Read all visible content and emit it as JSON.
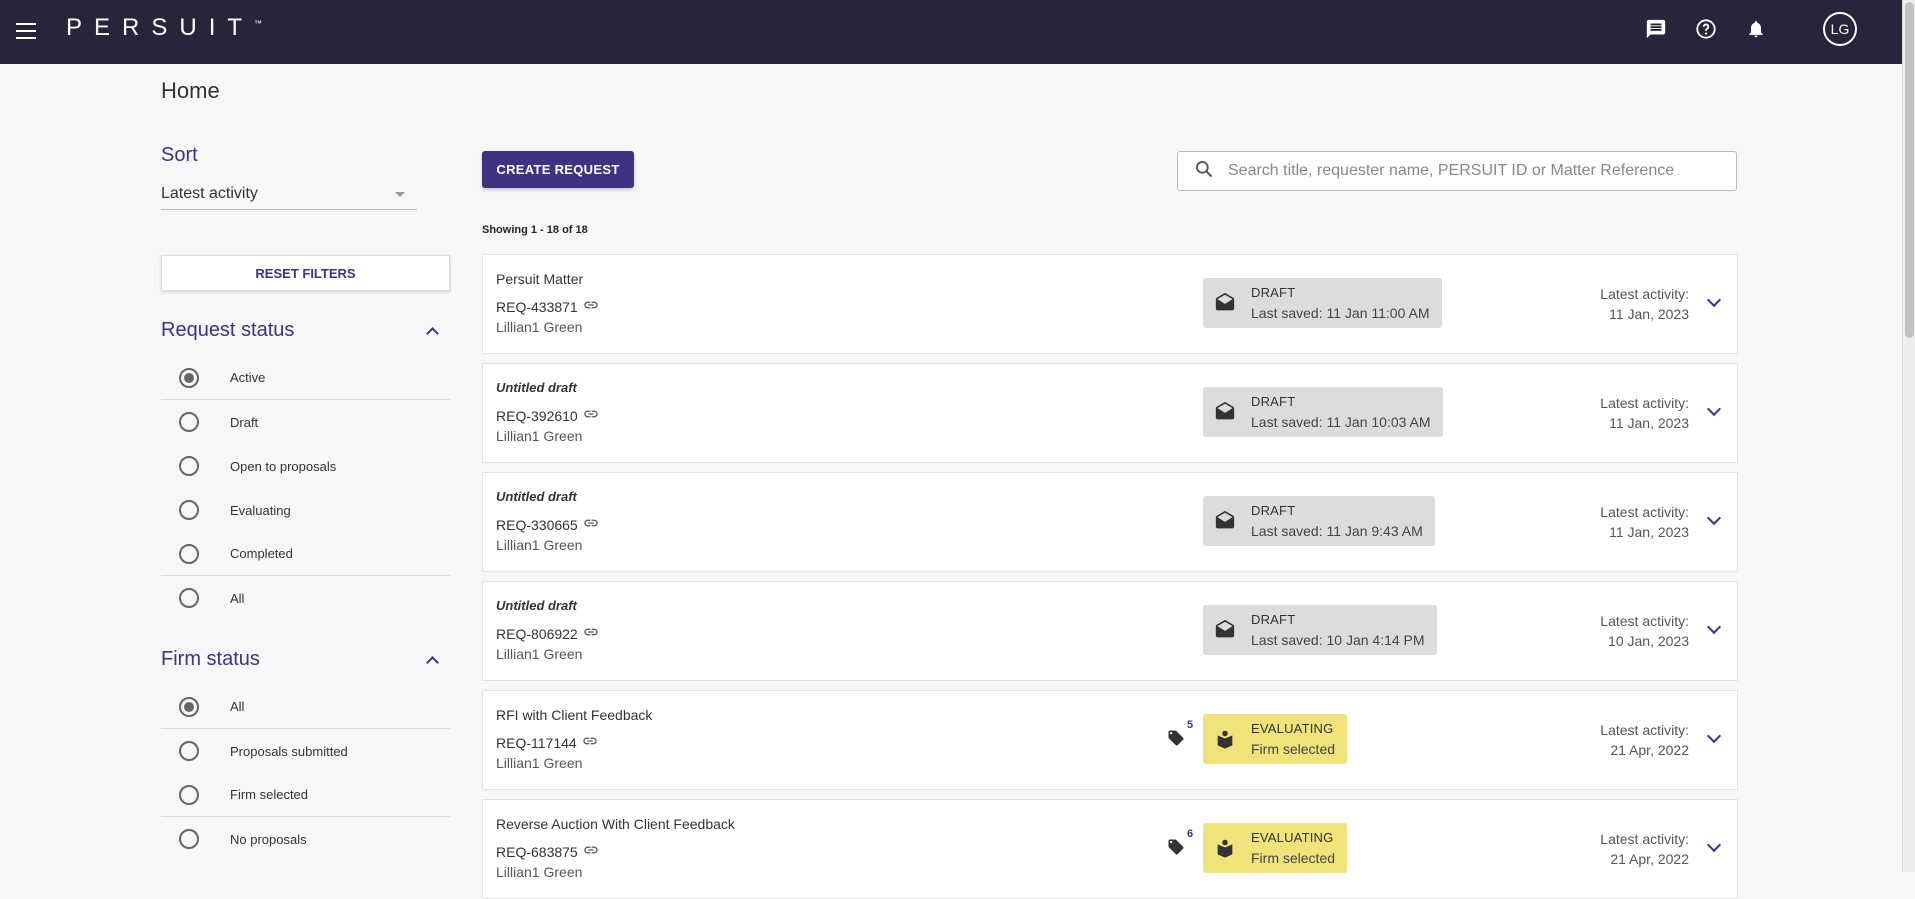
{
  "topbar": {
    "logo": "PERSUIT",
    "logo_tm": "™",
    "avatar": "LG"
  },
  "page": {
    "title": "Home"
  },
  "sort": {
    "title": "Sort",
    "selected": "Latest activity"
  },
  "reset_label": "RESET FILTERS",
  "request_status": {
    "title": "Request status",
    "options": [
      "Active",
      "Draft",
      "Open to proposals",
      "Evaluating",
      "Completed",
      "All"
    ],
    "selected": "Active"
  },
  "firm_status": {
    "title": "Firm status",
    "options": [
      "All",
      "Proposals submitted",
      "Firm selected",
      "No proposals"
    ],
    "selected": "All"
  },
  "create_label": "CREATE REQUEST",
  "search": {
    "placeholder": "Search title, requester name, PERSUIT ID or Matter Reference"
  },
  "showing": "Showing 1 - 18 of 18",
  "activity_label": "Latest activity:",
  "colors": {
    "brand": "#3d3382",
    "topbar": "#27253a",
    "draft_bg": "#dcdcdc",
    "eval_bg": "#efe37a"
  },
  "requests": [
    {
      "title": "Persuit Matter",
      "italic": false,
      "id": "REQ-433871",
      "requester": "Lillian1 Green",
      "status": "DRAFT",
      "substatus": "Last saved: 11 Jan 11:00 AM",
      "date": "11 Jan, 2023",
      "tags": ""
    },
    {
      "title": "Untitled draft",
      "italic": true,
      "id": "REQ-392610",
      "requester": "Lillian1 Green",
      "status": "DRAFT",
      "substatus": "Last saved: 11 Jan 10:03 AM",
      "date": "11 Jan, 2023",
      "tags": ""
    },
    {
      "title": "Untitled draft",
      "italic": true,
      "id": "REQ-330665",
      "requester": "Lillian1 Green",
      "status": "DRAFT",
      "substatus": "Last saved: 11 Jan 9:43 AM",
      "date": "11 Jan, 2023",
      "tags": ""
    },
    {
      "title": "Untitled draft",
      "italic": true,
      "id": "REQ-806922",
      "requester": "Lillian1 Green",
      "status": "DRAFT",
      "substatus": "Last saved: 10 Jan 4:14 PM",
      "date": "10 Jan, 2023",
      "tags": ""
    },
    {
      "title": "RFI with Client Feedback",
      "italic": false,
      "id": "REQ-117144",
      "requester": "Lillian1 Green",
      "status": "EVALUATING",
      "substatus": "Firm selected",
      "date": "21 Apr, 2022",
      "tags": "5"
    },
    {
      "title": "Reverse Auction With Client Feedback",
      "italic": false,
      "id": "REQ-683875",
      "requester": "Lillian1 Green",
      "status": "EVALUATING",
      "substatus": "Firm selected",
      "date": "21 Apr, 2022",
      "tags": "6"
    }
  ]
}
